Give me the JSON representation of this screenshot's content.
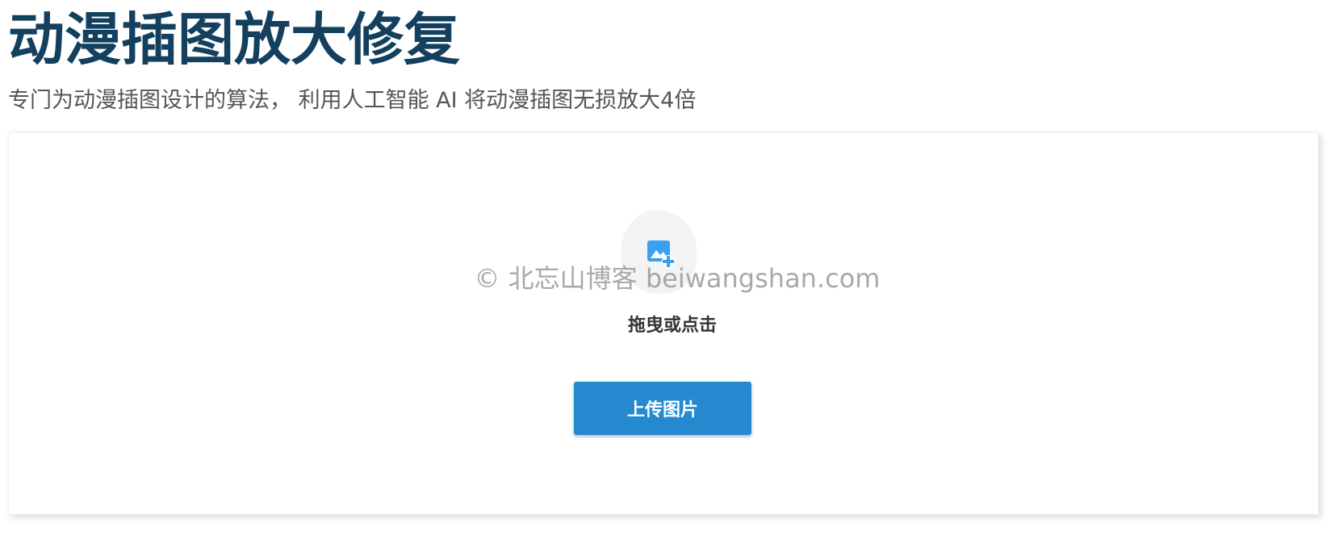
{
  "header": {
    "title": "动漫插图放大修复",
    "subtitle": "专门为动漫插图设计的算法， 利用人工智能 AI 将动漫插图无损放大4倍"
  },
  "upload": {
    "icon": "image-add-icon",
    "watermark": "© 北忘山博客 beiwangshan.com",
    "drag_hint": "拖曳或点击",
    "button_label": "上传图片"
  },
  "colors": {
    "title": "#14405f",
    "subtitle": "#555555",
    "accent": "#2589d0",
    "icon": "#3aa0f0"
  }
}
